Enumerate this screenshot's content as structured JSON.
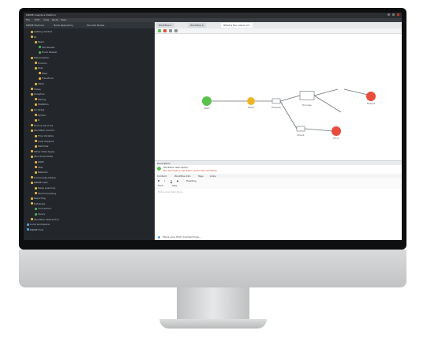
{
  "window": {
    "title": "KNIME Analytics Platform",
    "menu": [
      "File",
      "Edit",
      "View",
      "Node",
      "Help"
    ]
  },
  "left_panel": {
    "tabs": [
      "KNIME Explorer",
      "Node Repository",
      "Favorite Nodes"
    ],
    "tree": [
      {
        "label": "Getting started",
        "indent": 1,
        "color": "#e6b23c"
      },
      {
        "label": "IO",
        "indent": 1,
        "color": "#e6b23c"
      },
      {
        "label": "Read",
        "indent": 2,
        "color": "#e6b23c"
      },
      {
        "label": "File Reader",
        "indent": 3,
        "color": "#4caf50"
      },
      {
        "label": "Excel Reader",
        "indent": 3,
        "color": "#4caf50"
      },
      {
        "label": "Manipulation",
        "indent": 1,
        "color": "#e6b23c"
      },
      {
        "label": "Column",
        "indent": 2,
        "color": "#e6b23c"
      },
      {
        "label": "Row",
        "indent": 2,
        "color": "#e6b23c"
      },
      {
        "label": "Filter",
        "indent": 3,
        "color": "#e6b23c"
      },
      {
        "label": "Transform",
        "indent": 3,
        "color": "#e6b23c"
      },
      {
        "label": "Table",
        "indent": 2,
        "color": "#e6b23c"
      },
      {
        "label": "Views",
        "indent": 1,
        "color": "#e6b23c"
      },
      {
        "label": "Analytics",
        "indent": 1,
        "color": "#e6b23c"
      },
      {
        "label": "Mining",
        "indent": 2,
        "color": "#e6b23c"
      },
      {
        "label": "Statistics",
        "indent": 2,
        "color": "#e6b23c"
      },
      {
        "label": "Scripting",
        "indent": 1,
        "color": "#e6b23c"
      },
      {
        "label": "Python",
        "indent": 2,
        "color": "#e6b23c"
      },
      {
        "label": "R",
        "indent": 2,
        "color": "#e6b23c"
      },
      {
        "label": "Tools & Services",
        "indent": 1,
        "color": "#e6b23c"
      },
      {
        "label": "Workflow Control",
        "indent": 1,
        "color": "#e6b23c"
      },
      {
        "label": "Flow Variable",
        "indent": 2,
        "color": "#e6b23c"
      },
      {
        "label": "Loop Support",
        "indent": 2,
        "color": "#e6b23c"
      },
      {
        "label": "Switches",
        "indent": 2,
        "color": "#e6b23c"
      },
      {
        "label": "Other Data Types",
        "indent": 1,
        "color": "#e6b23c"
      },
      {
        "label": "Structured Data",
        "indent": 1,
        "color": "#e6b23c"
      },
      {
        "label": "JSON",
        "indent": 2,
        "color": "#e6b23c"
      },
      {
        "label": "XML",
        "indent": 2,
        "color": "#e6b23c"
      },
      {
        "label": "Network",
        "indent": 2,
        "color": "#e6b23c"
      },
      {
        "label": "Community Nodes",
        "indent": 1,
        "color": "#e6b23c"
      },
      {
        "label": "KNIME Labs",
        "indent": 1,
        "color": "#e6b23c"
      },
      {
        "label": "Deep Learning",
        "indent": 2,
        "color": "#e6b23c"
      },
      {
        "label": "Text Processing",
        "indent": 2,
        "color": "#e6b23c"
      },
      {
        "label": "Reporting",
        "indent": 1,
        "color": "#e6b23c"
      },
      {
        "label": "Database",
        "indent": 1,
        "color": "#e6b23c"
      },
      {
        "label": "Connectors",
        "indent": 2,
        "color": "#4caf50"
      },
      {
        "label": "Query",
        "indent": 2,
        "color": "#4caf50"
      },
      {
        "label": "Workflow Abstraction",
        "indent": 1,
        "color": "#e6b23c"
      },
      {
        "label": "Local workspace",
        "indent": 0,
        "color": "#5aa0d8"
      },
      {
        "label": "KNIME Hub",
        "indent": 0,
        "color": "#5aa0d8"
      }
    ]
  },
  "editor_tabs": [
    "Workflow 1",
    "Workflow 2",
    "What is the nature of..."
  ],
  "workflow": {
    "nodes": [
      {
        "name": "Start",
        "color": "#59c24a"
      },
      {
        "name": "Read",
        "color": "#f0b429"
      },
      {
        "name": "Prepare",
        "color": "#f0b429"
      },
      {
        "name": "Process",
        "color": "#f0b429"
      },
      {
        "name": "Output",
        "color": "#e74c3c"
      },
      {
        "name": "Check",
        "color": "#f0b429"
      },
      {
        "name": "Error",
        "color": "#e74c3c"
      }
    ]
  },
  "description": {
    "header": "Description",
    "info_text": "Workflow description",
    "warning": "No description has been set for this workflow",
    "tabs": [
      "Content",
      "Workflow Info",
      "Tags",
      "Links"
    ]
  },
  "editor": {
    "toolbar_items": [
      "B",
      "I",
      "U",
      "S",
      "Heading",
      "Font",
      "Size"
    ],
    "placeholder": "Enter your text here..."
  },
  "footer": {
    "comment_label": "Share your first comment here..."
  }
}
